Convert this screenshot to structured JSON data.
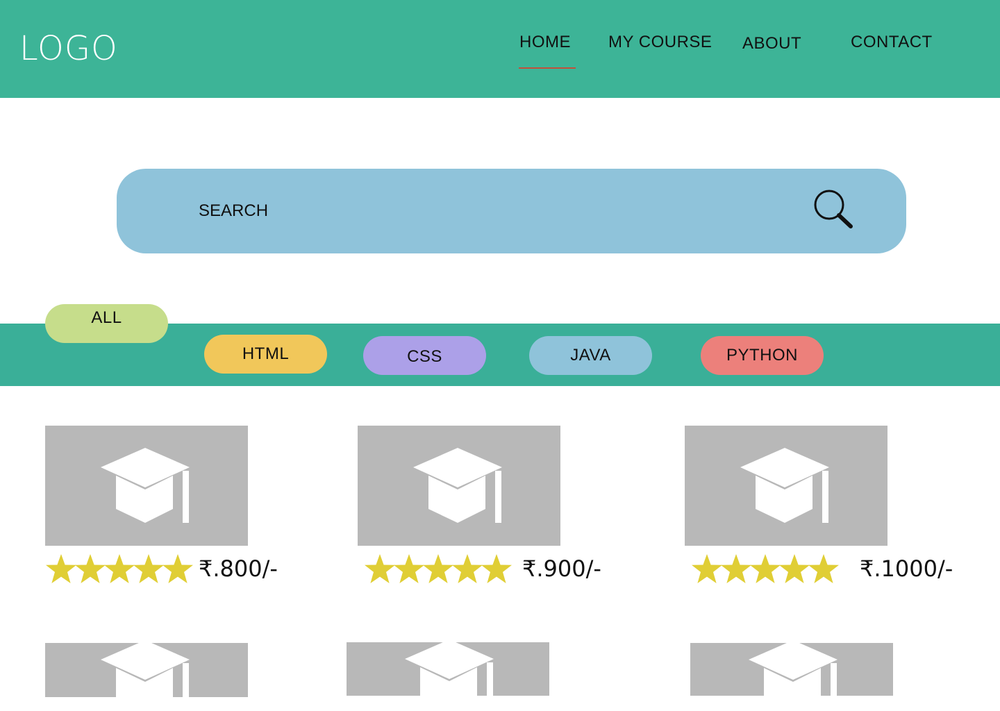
{
  "header": {
    "logo": "LOGO",
    "nav": [
      "HOME",
      "MY COURSE",
      "ABOUT",
      "CONTACT"
    ],
    "active_nav": "HOME"
  },
  "search": {
    "placeholder": "SEARCH",
    "icon": "search-icon"
  },
  "filters": [
    "ALL",
    "HTML",
    "CSS",
    "JAVA",
    "PYTHON"
  ],
  "courses": [
    {
      "rating": 5,
      "price": "₹.800/-"
    },
    {
      "rating": 5,
      "price": "₹.900/-"
    },
    {
      "rating": 5,
      "price": "₹.1000/-"
    }
  ],
  "icons": {
    "course_image": "graduation-cap-icon",
    "rating": "star-icon"
  },
  "colors": {
    "header": "#3db497",
    "nav_active_underline": "#c2503a",
    "search": "#8fc3da",
    "filter_band": "#3aaf98",
    "filter_all": "#c6dd8b",
    "filter_html": "#f1c75a",
    "filter_css": "#aca0e8",
    "filter_java": "#8fc3da",
    "filter_python": "#ec807b",
    "card_image": "#b8b8b8",
    "star": "#e0ce35"
  }
}
